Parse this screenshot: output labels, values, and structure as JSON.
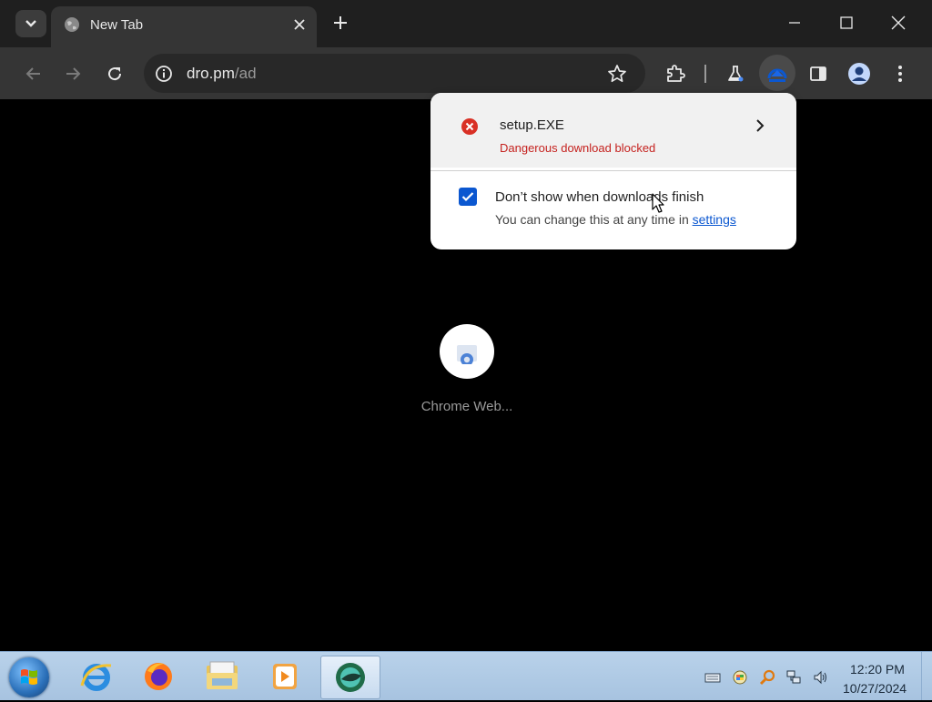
{
  "browser": {
    "tab": {
      "title": "New Tab"
    },
    "omnibox": {
      "host": "dro.pm",
      "path": "/ad"
    }
  },
  "download_bubble": {
    "filename": "setup.EXE",
    "status": "Dangerous download blocked",
    "checkbox_label": "Don’t show when downloads finish",
    "checkbox_checked": true,
    "note_prefix": "You can change this at any time in ",
    "note_link": "settings"
  },
  "new_tab_page": {
    "shortcut_label": "Chrome Web..."
  },
  "taskbar": {
    "time": "12:20 PM",
    "date": "10/27/2024"
  },
  "colors": {
    "danger": "#c5221f",
    "accent": "#0b57d0"
  }
}
